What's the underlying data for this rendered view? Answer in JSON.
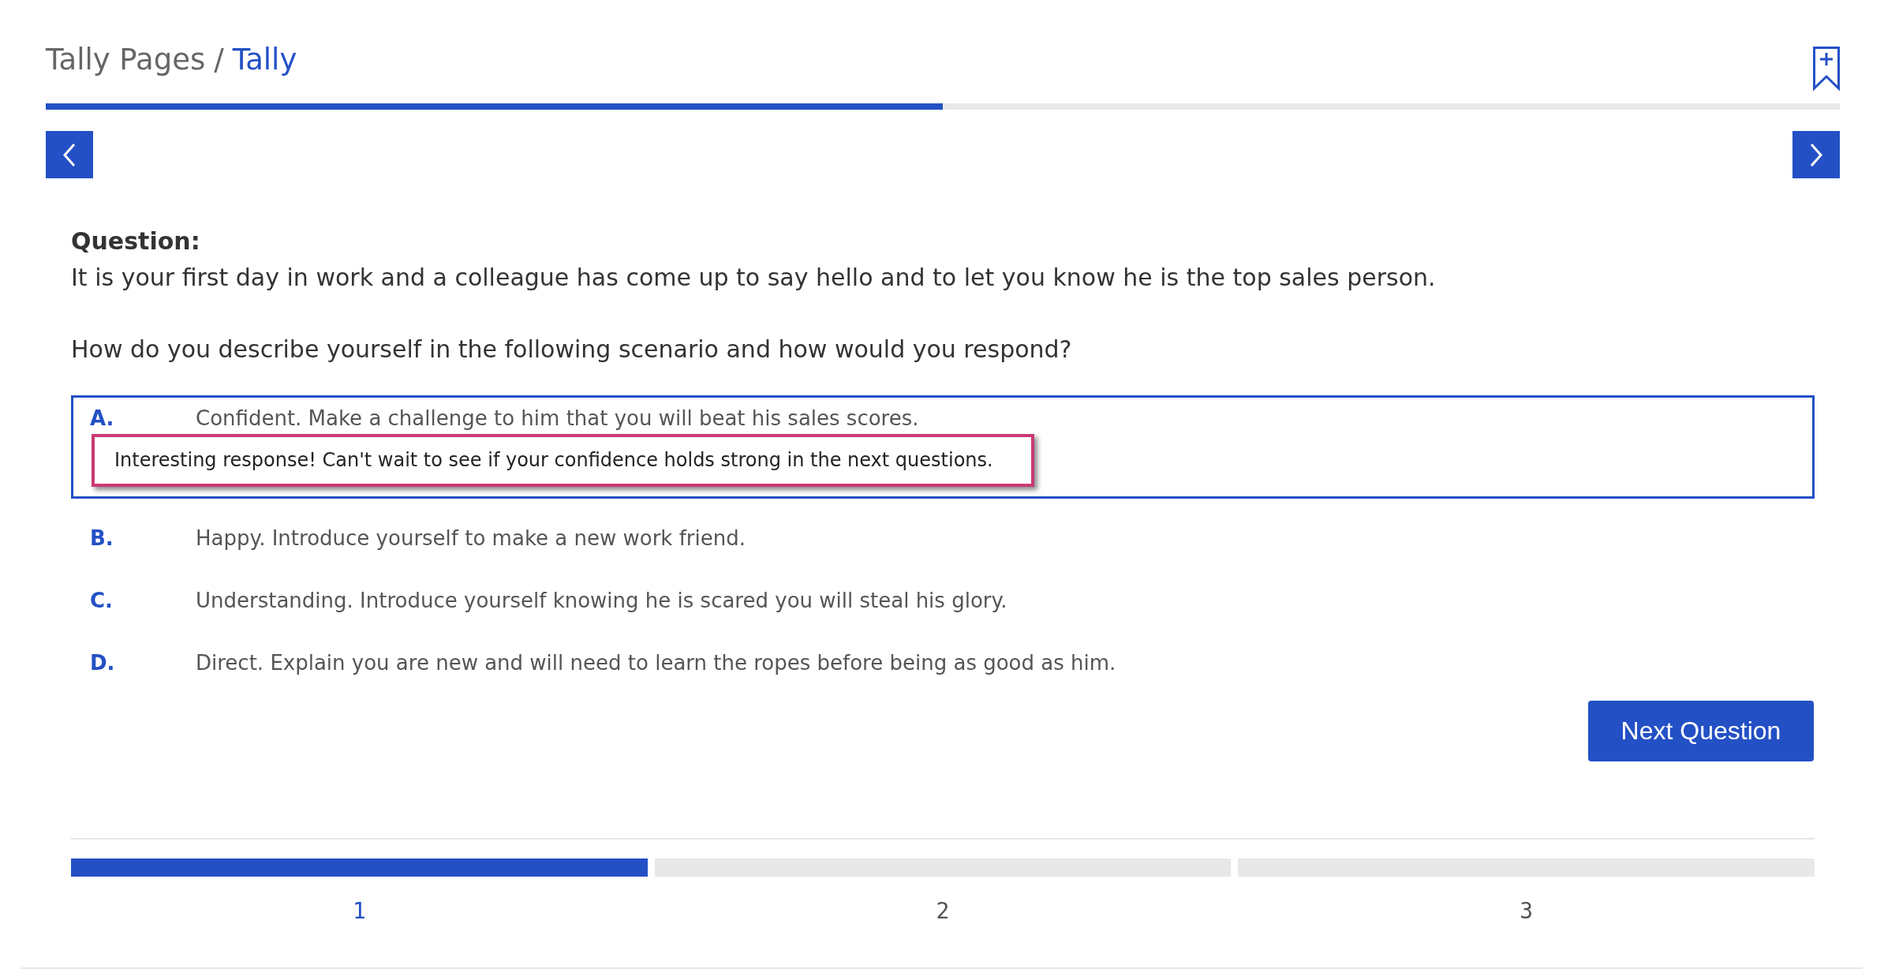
{
  "breadcrumb": {
    "items": [
      {
        "label": "Tally Pages",
        "selected": false
      },
      {
        "label": "Tally",
        "selected": true
      }
    ],
    "separator": "/"
  },
  "progress": {
    "level": 0.5
  },
  "question": {
    "label": "Question:",
    "paragraphs": [
      "It is your first day in work and a colleague has come up to say hello and to let you know he is the top sales person.",
      "How do you describe yourself in the following scenario and how would you respond?"
    ]
  },
  "answers": [
    {
      "letter": "A.",
      "text": "Confident. Make a challenge to him that you will beat his sales scores.",
      "selected": true,
      "feedback": "Interesting response! Can't wait to see if your confidence holds strong in the next questions."
    },
    {
      "letter": "B.",
      "text": "Happy. Introduce yourself to make a new work friend.",
      "selected": false
    },
    {
      "letter": "C.",
      "text": "Understanding. Introduce yourself knowing he is scared you will steal his glory.",
      "selected": false
    },
    {
      "letter": "D.",
      "text": "Direct. Explain you are new and will need to learn the ropes before being as good as him.",
      "selected": false
    }
  ],
  "next_button": {
    "label": "Next Question"
  },
  "steps": [
    {
      "label": "1",
      "selected": true
    },
    {
      "label": "2",
      "selected": false
    },
    {
      "label": "3",
      "selected": false
    }
  ]
}
